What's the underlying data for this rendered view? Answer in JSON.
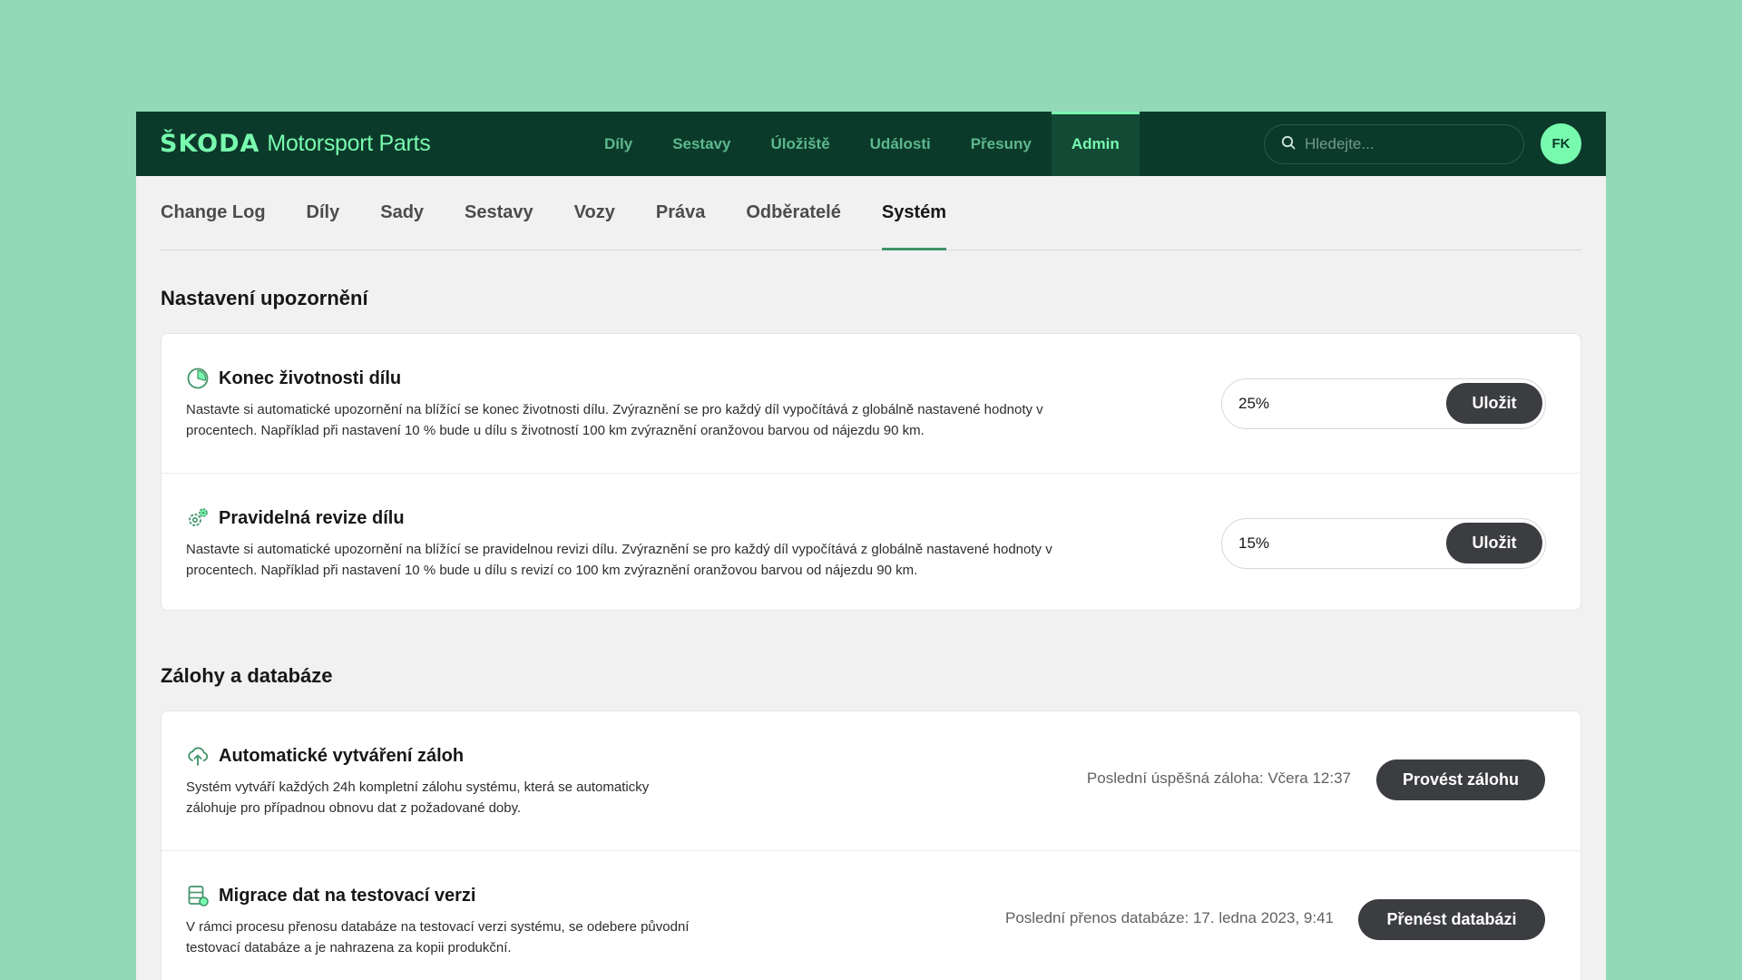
{
  "header": {
    "brand_logo": "ŠKODA",
    "brand_name": "Motorsport Parts",
    "nav": [
      {
        "label": "Díly"
      },
      {
        "label": "Sestavy"
      },
      {
        "label": "Úložiště"
      },
      {
        "label": "Události"
      },
      {
        "label": "Přesuny"
      },
      {
        "label": "Admin",
        "active": true
      }
    ],
    "search_placeholder": "Hledejte...",
    "search_icon": "search-icon",
    "avatar_initials": "FK"
  },
  "tabs": [
    {
      "label": "Change Log"
    },
    {
      "label": "Díly"
    },
    {
      "label": "Sady"
    },
    {
      "label": "Sestavy"
    },
    {
      "label": "Vozy"
    },
    {
      "label": "Práva"
    },
    {
      "label": "Odběratelé"
    },
    {
      "label": "Systém",
      "active": true
    }
  ],
  "notifications": {
    "title": "Nastavení upozornění",
    "items": [
      {
        "icon": "lifetime-gauge-icon",
        "title": "Konec životnosti dílu",
        "description": "Nastavte si automatické upozornění na blížící se konec životnosti dílu. Zvýraznění se pro každý díl vypočítává z globálně nastavené hodnoty v procentech. Například při nastavení 10 % bude u dílu s životností 100 km zvýraznění oranžovou barvou od nájezdu 90 km.",
        "value": "25%",
        "save_label": "Uložit"
      },
      {
        "icon": "gears-icon",
        "title": "Pravidelná revize dílu",
        "description": "Nastavte si automatické upozornění na blížící se pravidelnou revizi dílu. Zvýraznění se pro každý díl vypočítává z globálně nastavené hodnoty v procentech. Například při nastavení 10 % bude u dílu s revizí co 100 km zvýraznění oranžovou barvou od nájezdu 90 km.",
        "value": "15%",
        "save_label": "Uložit"
      }
    ]
  },
  "backups": {
    "title": "Zálohy a databáze",
    "items": [
      {
        "icon": "cloud-upload-icon",
        "title": "Automatické vytváření záloh",
        "description": "Systém vytváří každých 24h kompletní zálohu systému, která se automaticky zálohuje pro případnou obnovu dat z požadované doby.",
        "status": "Poslední úspěšná záloha: Včera 12:37",
        "action_label": "Provést zálohu"
      },
      {
        "icon": "database-sync-icon",
        "title": "Migrace dat na testovací verzi",
        "description": "V rámci procesu přenosu databáze na testovací verzi systému, se odebere původní testovací databáze a je nahrazena za kopii produkční.",
        "status": "Poslední přenos databáze: 17. ledna 2023, 9:41",
        "action_label": "Přenést databázi"
      }
    ]
  },
  "colors": {
    "background": "#92d9b8",
    "topbar": "#0b3a2b",
    "accent": "#78faae",
    "tab_underline": "#419468",
    "button_dark": "#3b3d40"
  }
}
